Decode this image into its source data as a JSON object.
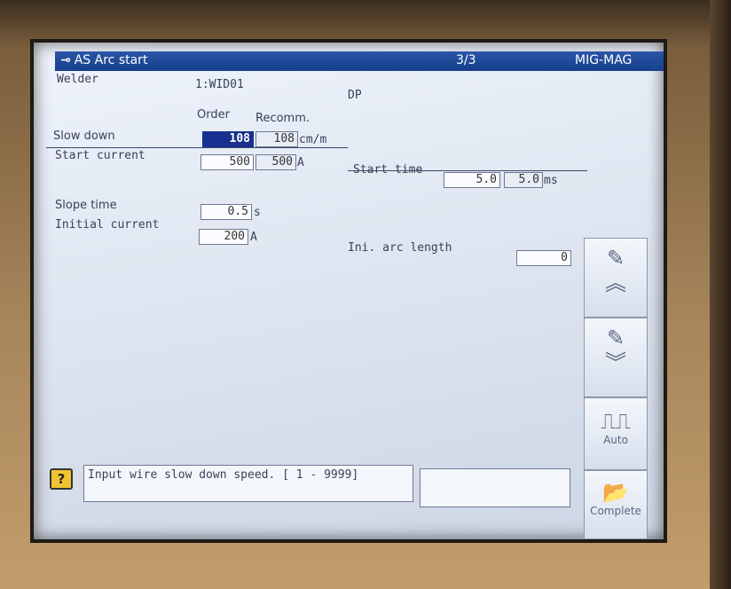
{
  "header": {
    "title": "AS Arc start",
    "page": "3/3",
    "mode": "MIG-MAG"
  },
  "welder": {
    "label": "Welder",
    "value": "1:WID01",
    "process": "DP"
  },
  "columns": {
    "order": "Order",
    "recommended": "Recomm."
  },
  "slow_down": {
    "label": "Slow down",
    "order": "108",
    "recomm": "108",
    "unit": "cm/m"
  },
  "start_current": {
    "label": "Start current",
    "order": "500",
    "recomm": "500",
    "unit": "A"
  },
  "start_time": {
    "label": "Start time",
    "order": "5.0",
    "recomm": "5.0",
    "unit": "ms"
  },
  "slope_time": {
    "label": "Slope time",
    "order": "0.5",
    "unit": "s"
  },
  "initial_current": {
    "label": "Initial current",
    "order": "200",
    "unit": "A"
  },
  "ini_arc_length": {
    "label": "Ini. arc length",
    "value": "0"
  },
  "side_buttons": {
    "auto_label": "Auto",
    "complete_label": "Complete"
  },
  "message": {
    "text": "Input wire slow down speed.  [   1 - 9999]"
  },
  "icons": [
    "plug-icon",
    "book-up-icon",
    "double-chevron-up-icon",
    "book-down-icon",
    "double-chevron-down-icon",
    "pulse-wave-icon",
    "folder-complete-icon",
    "question-icon"
  ]
}
